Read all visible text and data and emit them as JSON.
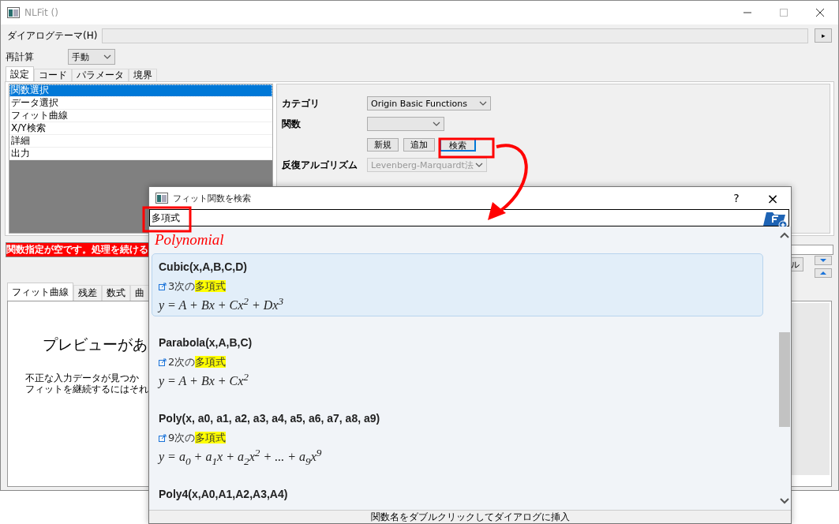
{
  "window": {
    "title": "NLFit ()"
  },
  "dialog_theme": {
    "label": "ダイアログテーマ(H)",
    "button": "▸"
  },
  "recalculate": {
    "label": "再計算",
    "value": "手動"
  },
  "tabs": [
    {
      "label": "設定",
      "selected": true
    },
    {
      "label": "コード",
      "selected": false
    },
    {
      "label": "パラメータ",
      "selected": false
    },
    {
      "label": "境界",
      "selected": false
    }
  ],
  "pages": [
    {
      "label": "関数選択",
      "selected": true
    },
    {
      "label": "データ選択",
      "selected": false
    },
    {
      "label": "フィット曲線",
      "selected": false
    },
    {
      "label": "X/Y検索",
      "selected": false
    },
    {
      "label": "詳細",
      "selected": false
    },
    {
      "label": "出力",
      "selected": false
    }
  ],
  "settings": {
    "category": {
      "label": "カテゴリ",
      "value": "Origin Basic Functions"
    },
    "function": {
      "label": "関数"
    },
    "buttons": [
      {
        "label": "新規",
        "focused": false
      },
      {
        "label": "追加",
        "focused": false
      },
      {
        "label": "検索",
        "focused": true
      }
    ],
    "algorithm": {
      "label": "反復アルゴリズム",
      "value": "Levenberg-Marquardt法",
      "disabled": true
    }
  },
  "error_message": "関数指定が空です。処理を続ける",
  "cut_button": "ル",
  "preview_tabs": [
    {
      "label": "フィット曲線",
      "selected": true
    },
    {
      "label": "残差",
      "selected": false
    },
    {
      "label": "数式",
      "selected": false
    },
    {
      "label": "曲",
      "selected": false
    }
  ],
  "preview": {
    "title": "プレビューがあ",
    "lines": [
      "不正な入力データが見つか",
      "フィットを継続するにはそれ"
    ]
  },
  "search_dialog": {
    "title": "フィット関数を検索",
    "help": "?",
    "close": "×",
    "query": "多項式",
    "category": "Polynomial",
    "results": [
      {
        "name": "Cubic(x,A,B,C,D)",
        "selected": true,
        "description": "3次の",
        "match": "多項式",
        "formula": "y = A + Bx + Cx$^{2}$ + Dx$^{3}$"
      },
      {
        "name": "Parabola(x,A,B,C)",
        "selected": false,
        "description": "2次の",
        "match": "多項式",
        "formula": "y = A + Bx + Cx$^{2}$"
      },
      {
        "name": "Poly(x, a0, a1, a2, a3, a4, a5, a6, a7, a8, a9)",
        "selected": false,
        "description": "9次の",
        "match": "多項式",
        "formula": "y = a$_{0}$ + a$_{1}$x + a$_{2}$x$^{2}$ + ... + a$_{9}$x$^{9}$"
      },
      {
        "name": "Poly4(x,A0,A1,A2,A3,A4)",
        "selected": false
      }
    ],
    "status": "関数名をダブルクリックしてダイアログに挿入"
  }
}
